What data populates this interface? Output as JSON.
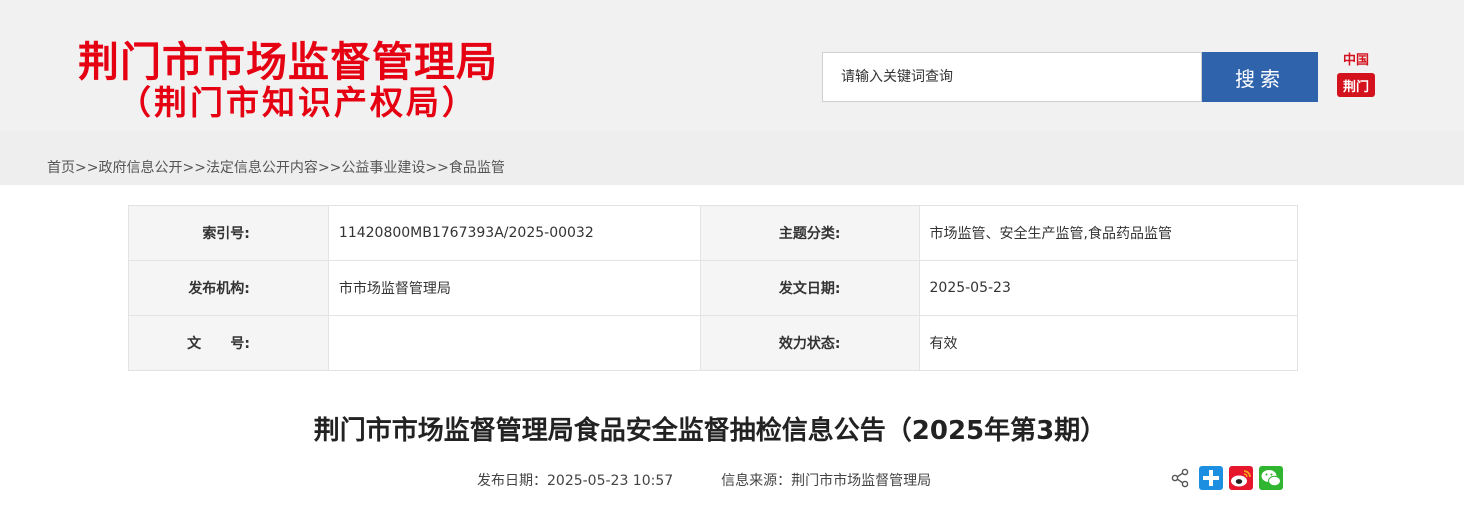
{
  "header": {
    "site_title_line1": "荆门市市场监督管理局",
    "site_title_line2": "（荆门市知识产权局）",
    "search": {
      "placeholder": "请输入关键词查询",
      "button_label": "搜索"
    },
    "seal": {
      "top_text": "中国",
      "bottom_text": "荆门"
    }
  },
  "breadcrumb": {
    "items": [
      "首页",
      "政府信息公开",
      "法定信息公开内容",
      "公益事业建设",
      "食品监管"
    ],
    "separator": ">>"
  },
  "info_table": {
    "rows": [
      {
        "label1": "索引号:",
        "value1": "11420800MB1767393A/2025-00032",
        "label2": "主题分类:",
        "value2": "市场监管、安全生产监管,食品药品监管"
      },
      {
        "label1": "发布机构:",
        "value1": "市市场监督管理局",
        "label2": "发文日期:",
        "value2": "2025-05-23"
      },
      {
        "label1": "文      号:",
        "value1": "",
        "label2": "效力状态:",
        "value2": "有效"
      }
    ]
  },
  "article": {
    "title": "荆门市市场监督管理局食品安全监督抽检信息公告（2025年第3期）",
    "publish_date": "发布日期：2025-05-23 10:57",
    "source": "信息来源：荆门市市场监督管理局"
  },
  "share": {
    "icons": [
      "share-icon",
      "plus-share-icon",
      "weibo-icon",
      "wechat-icon"
    ]
  },
  "colors": {
    "brand_red": "#e50012",
    "search_blue": "#2f64ad",
    "header_bg": "#f1f1f1",
    "breadcrumb_bg": "#eeeeee"
  }
}
